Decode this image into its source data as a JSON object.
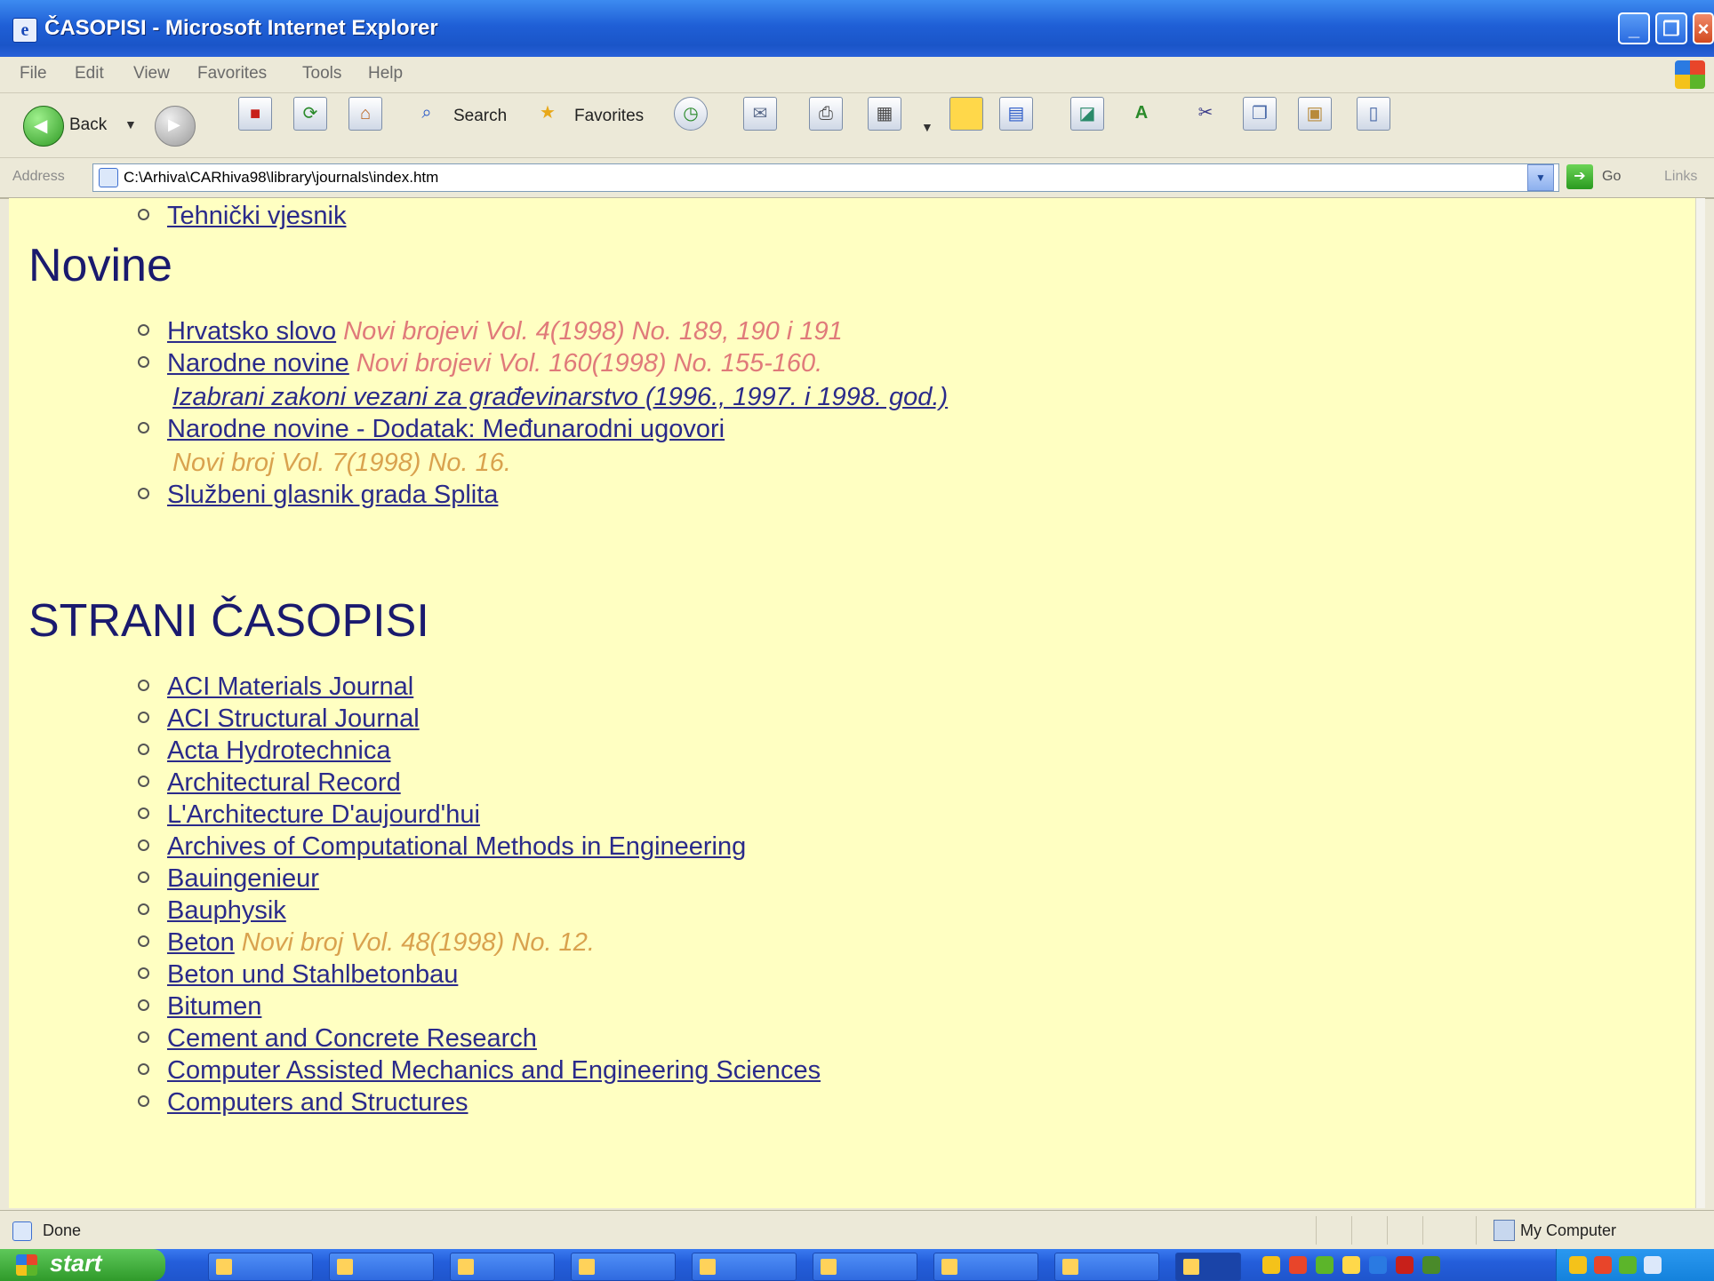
{
  "window": {
    "title": "ČASOPISI - Microsoft Internet Explorer"
  },
  "menu": [
    "File",
    "Edit",
    "View",
    "Favorites",
    "Tools",
    "Help"
  ],
  "toolbar": {
    "back": "Back",
    "search": "Search",
    "favorites": "Favorites"
  },
  "address": {
    "label": "Address",
    "url": "C:\\Arhiva\\CARhiva98\\library\\journals\\index.htm",
    "go": "Go",
    "links": "Links"
  },
  "content": {
    "top_item": "Tehnički vjesnik",
    "novine_heading": "Novine",
    "novine": [
      {
        "link": "Hrvatsko slovo",
        "note": "Novi brojevi Vol. 4(1998) No. 189, 190 i 191"
      },
      {
        "link": "Narodne novine",
        "note": "Novi brojevi Vol. 160(1998) No. 155-160.",
        "sub": "Izabrani zakoni vezani za građevinarstvo (1996., 1997. i 1998. god.)"
      },
      {
        "link": "Narodne novine - Dodatak: Međunarodni ugovori",
        "sub_note": "Novi broj Vol. 7(1998) No. 16."
      },
      {
        "link": "Službeni glasnik grada Splita"
      }
    ],
    "strani_heading": "STRANI ČASOPISI",
    "strani": [
      "ACI Materials Journal",
      "ACI Structural Journal",
      "Acta Hydrotechnica",
      "Architectural Record",
      "L'Architecture D'aujourd'hui",
      "Archives of Computational Methods in Engineering",
      "Bauingenieur",
      "Bauphysik",
      "Beton",
      "Beton und Stahlbetonbau",
      "Bitumen",
      "Cement and Concrete Research",
      "Computer Assisted Mechanics and Engineering Sciences",
      "Computers and Structures"
    ],
    "beton_note": "Novi broj Vol. 48(1998) No. 12."
  },
  "status": {
    "text": "Done",
    "zone": "My Computer"
  },
  "taskbar": {
    "start": "start"
  },
  "colors": {
    "page_bg": "#ffffc2",
    "link": "#2a2a8a",
    "heading": "#1a1a6e",
    "note_pink": "#e07a7a",
    "note_orange": "#d9a24e"
  }
}
